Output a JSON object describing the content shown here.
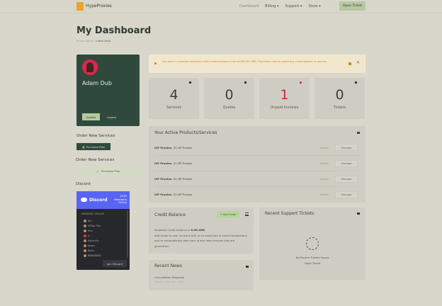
{
  "nav": {
    "brand": "HypeProxies",
    "items": [
      "Dashboard",
      "Billing ▾",
      "Support ▾",
      "Store ▾"
    ],
    "open_ticket": "Open Ticket"
  },
  "page": {
    "title": "My Dashboard",
    "breadcrumb_home": "Portal Home",
    "breadcrumb_current": "Client Area"
  },
  "profile": {
    "name": "Adam Dub",
    "update": "Update",
    "logout": "Logout"
  },
  "sidebar": {
    "order1": "Order New Services",
    "purchase1": "Purchase Plan",
    "order2": "Order New Services",
    "purchase2": "Purchase Plan",
    "discord_label": "Discord"
  },
  "discord": {
    "title": "Discord",
    "count": "2233",
    "count_label1": "Members",
    "count_label2": "Online",
    "members_online": "MEMBERS ONLINE",
    "members": [
      "fan",
      "30Top Tier",
      "90u",
      "a..",
      "AvilanGo",
      "beam",
      "Boris",
      "BRANDING"
    ],
    "join": "Join Discord"
  },
  "alert": {
    "text": "You have 1 overdue invoice(s) with a total balance due of $50.00 USD. Pay them now to avoid any interruptions in service.",
    "close": "✕"
  },
  "stats": [
    {
      "value": "4",
      "label": "Services"
    },
    {
      "value": "0",
      "label": "Quotes"
    },
    {
      "value": "1",
      "label": "Unpaid Invoices"
    },
    {
      "value": "0",
      "label": "Tickets"
    }
  ],
  "colors": {
    "accent": "#2f4a3d",
    "danger": "#d2243f",
    "active": "#7fa25a",
    "button_light": "#b7c8a0"
  },
  "products": {
    "title": "Your Active Products/Services",
    "rows": [
      {
        "name": "ISP Proxies",
        "desc": " - 25 ISP Proxies",
        "status": "Active",
        "action": "Manage"
      },
      {
        "name": "ISP Proxies",
        "desc": " - 25 ISP Proxies",
        "status": "Active",
        "action": "Manage"
      },
      {
        "name": "ISP Proxies",
        "desc": " - 25 ISP Proxies",
        "status": "Active",
        "action": "Manage"
      },
      {
        "name": "ISP Proxies",
        "desc": " - 25 ISP Proxies",
        "status": "Active",
        "action": "Manage"
      }
    ]
  },
  "credit": {
    "title": "Credit Balance",
    "add_funds": "Add Funds",
    "line1": "Available Credit balance is ",
    "amount": "0.00 USD",
    "desc": "Add funds to your account with us to avoid lots of small transactions and to automatically take care of any new invoices that are generated."
  },
  "news": {
    "title": "Recent News",
    "item": "Cancellation Requests",
    "date": "Sunday, May 19th, 2013"
  },
  "tickets": {
    "title": "Recent Support Tickets",
    "empty": "No Recent Tickets Found",
    "open": "Open Ticket"
  }
}
